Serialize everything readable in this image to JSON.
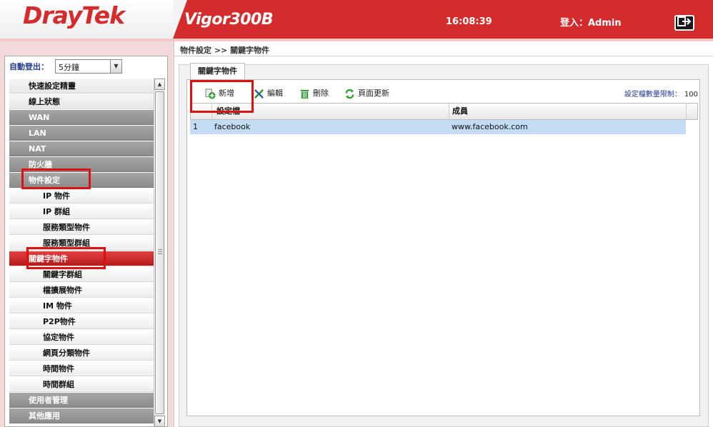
{
  "header": {
    "logo": "DrayTek",
    "model": "Vigor300B",
    "clock": "16:08:39",
    "login_label": "登入：Admin",
    "logout_icon": "logout-arrow-icon"
  },
  "sidebar": {
    "auto_logout_label": "自動登出：",
    "auto_logout_value": "5分鐘",
    "items": [
      {
        "label": "快速設定精靈",
        "kind": "light"
      },
      {
        "label": "線上狀態",
        "kind": "light"
      },
      {
        "label": "WAN",
        "kind": "dark"
      },
      {
        "label": "LAN",
        "kind": "dark"
      },
      {
        "label": "NAT",
        "kind": "dark"
      },
      {
        "label": "防火牆",
        "kind": "dark"
      },
      {
        "label": "物件設定",
        "kind": "dark"
      },
      {
        "label": "IP 物件",
        "kind": "sub"
      },
      {
        "label": "IP 群組",
        "kind": "sub"
      },
      {
        "label": "服務類型物件",
        "kind": "sub"
      },
      {
        "label": "服務類型群組",
        "kind": "sub"
      },
      {
        "label": "關鍵字物件",
        "kind": "active"
      },
      {
        "label": "關鍵字群組",
        "kind": "sub"
      },
      {
        "label": "檔擴展物件",
        "kind": "sub"
      },
      {
        "label": "IM 物件",
        "kind": "sub"
      },
      {
        "label": "P2P物件",
        "kind": "sub"
      },
      {
        "label": "協定物件",
        "kind": "sub"
      },
      {
        "label": "網頁分類物件",
        "kind": "sub"
      },
      {
        "label": "時間物件",
        "kind": "sub"
      },
      {
        "label": "時間群組",
        "kind": "sub"
      },
      {
        "label": "使用者管理",
        "kind": "dark"
      },
      {
        "label": "其他應用",
        "kind": "dark"
      }
    ]
  },
  "content": {
    "breadcrumb": "物件設定 >> 關鍵字物件",
    "tab_label": "關鍵字物件",
    "toolbar": {
      "add_label": "新增",
      "edit_label": "編輯",
      "delete_label": "刪除",
      "refresh_label": "頁面更新",
      "limit_label": "設定檔數量限制：",
      "limit_value": "100"
    },
    "table": {
      "columns": [
        "設定檔",
        "成員"
      ],
      "rows": [
        {
          "index": "1",
          "profile": "facebook",
          "member": "www.facebook.com"
        }
      ]
    }
  },
  "colors": {
    "brand_red": "#d42c2c",
    "highlight_red": "#e01010",
    "selected_row": "#c3dcf3"
  }
}
